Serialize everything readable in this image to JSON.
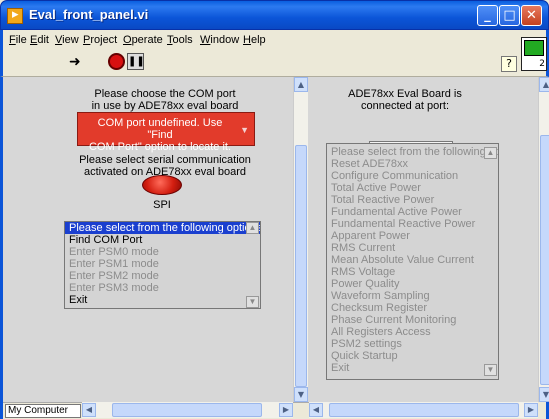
{
  "window": {
    "title": "Eval_front_panel.vi"
  },
  "menu": [
    "File",
    "Edit",
    "View",
    "Project",
    "Operate",
    "Tools",
    "Window",
    "Help"
  ],
  "toolbar": {
    "run_icon": "run-arrow-icon",
    "stop_icon": "abort-icon",
    "pause_icon": "pause-icon",
    "help_glyph": "?",
    "vi_icon_number": "2"
  },
  "left_panel": {
    "com_prompt_line1": "Please choose the COM port",
    "com_prompt_line2": "in use by ADE78xx eval board",
    "com_status_line1": "COM port undefined. Use \"Find",
    "com_status_line2": "COM Port\" option to locate it.",
    "serial_prompt_line1": "Please select serial communication",
    "serial_prompt_line2": "activated on ADE78xx eval board",
    "spi_label": "SPI",
    "options": [
      {
        "label": "Please select from the following options",
        "state": "selected"
      },
      {
        "label": "Find COM Port",
        "state": "enabled"
      },
      {
        "label": "Enter PSM0 mode",
        "state": "disabled"
      },
      {
        "label": "Enter PSM1 mode",
        "state": "disabled"
      },
      {
        "label": "Enter PSM2 mode",
        "state": "disabled"
      },
      {
        "label": "Enter PSM3 mode",
        "state": "disabled"
      },
      {
        "label": "Exit",
        "state": "enabled"
      }
    ]
  },
  "right_panel": {
    "port_label_line1": "ADE78xx Eval Board is",
    "port_label_line2": "connected at port:",
    "port_value": "",
    "options": [
      "Please select from the following opti",
      "Reset ADE78xx",
      "Configure Communication",
      "Total Active Power",
      "Total Reactive Power",
      "Fundamental Active Power",
      "Fundamental Reactive Power",
      "Apparent Power",
      "RMS Current",
      "Mean Absolute Value Current",
      "RMS Voltage",
      "Power Quality",
      "Waveform Sampling",
      "Checksum Register",
      "Phase Current Monitoring",
      "All Registers Access",
      "PSM2 settings",
      "Quick Startup",
      "Exit"
    ]
  },
  "status_bar": {
    "context": "My Computer"
  }
}
